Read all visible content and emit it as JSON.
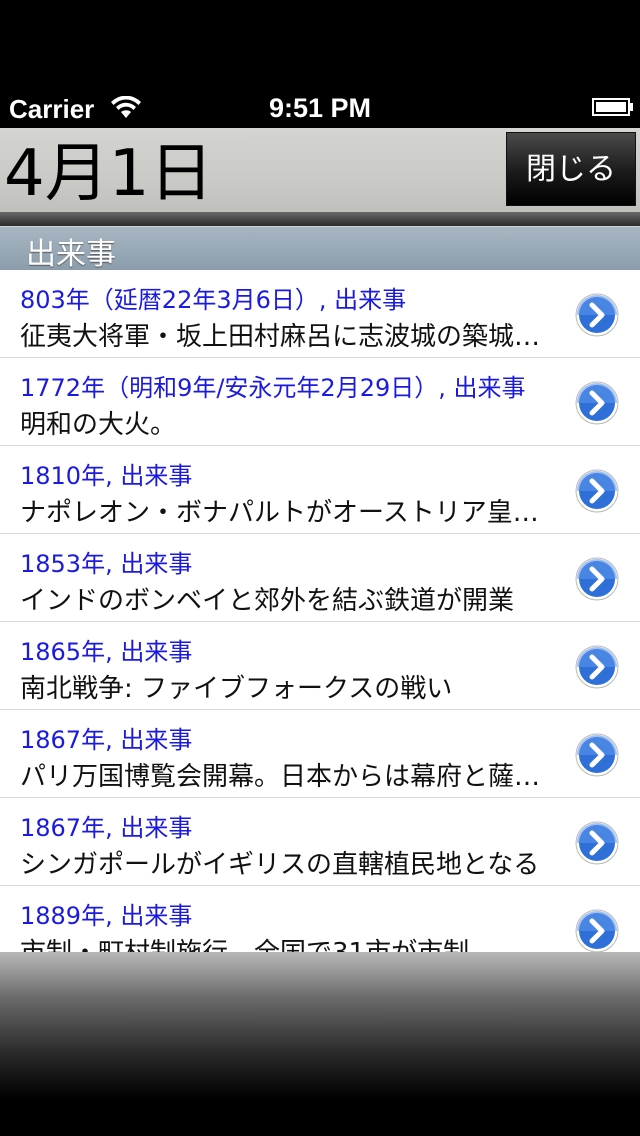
{
  "status_bar": {
    "carrier": "Carrier",
    "time": "9:51 PM"
  },
  "header": {
    "title": "4月1日",
    "close_label": "閉じる"
  },
  "section": {
    "title": "出来事"
  },
  "events": [
    {
      "title": "803年（延暦22年3月6日）, 出来事",
      "desc": "征夷大将軍・坂上田村麻呂に志波城の築城を命じる"
    },
    {
      "title": "1772年（明和9年/安永元年2月29日）, 出来事",
      "desc": "明和の大火。"
    },
    {
      "title": "1810年, 出来事",
      "desc": "ナポレオン・ボナパルトがオーストリア皇女と結婚"
    },
    {
      "title": "1853年, 出来事",
      "desc": "インドのボンベイと郊外を結ぶ鉄道が開業"
    },
    {
      "title": "1865年, 出来事",
      "desc": "南北戦争: ファイブフォークスの戦い"
    },
    {
      "title": "1867年, 出来事",
      "desc": "パリ万国博覧会開幕。日本からは幕府と薩摩藩が出展"
    },
    {
      "title": "1867年, 出来事",
      "desc": "シンガポールがイギリスの直轄植民地となる"
    },
    {
      "title": "1889年, 出来事",
      "desc": "市制・町村制施行。全国で31市が市制"
    }
  ],
  "colors": {
    "event_title": "#1a1ae0",
    "disclosure": "#2f6fd8"
  }
}
